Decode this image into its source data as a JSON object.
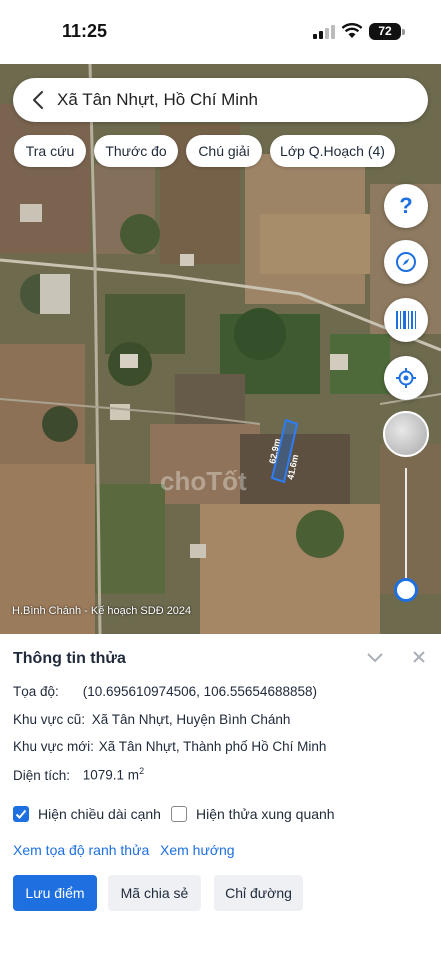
{
  "status_bar": {
    "time": "11:25",
    "battery": "72"
  },
  "search": {
    "location": "Xã Tân Nhựt, Hồ Chí Minh"
  },
  "chips": [
    {
      "label": "Tra cứu"
    },
    {
      "label": "Thước đo"
    },
    {
      "label": "Chú giải"
    },
    {
      "label": "Lớp Q.Hoạch (4)"
    }
  ],
  "map": {
    "caption": "H.Bình Chánh - Kế hoạch SDĐ 2024",
    "parcel_side_a": "62.9m",
    "parcel_side_b": "41.6m",
    "watermark": "choTốt",
    "fab_help": "?",
    "zoom_level_fraction": 0.0
  },
  "info": {
    "title": "Thông tin thửa",
    "coords_label": "Tọa độ:",
    "coords_value": "(10.695610974506, 106.55654688858)",
    "old_area_label": "Khu vực cũ:",
    "old_area_value": "Xã Tân Nhựt, Huyện Bình Chánh",
    "new_area_label": "Khu vực mới:",
    "new_area_value": "Xã Tân Nhựt, Thành phố Hồ Chí Minh",
    "size_label": "Diện tích:",
    "size_value": "1079.1 m",
    "size_unit_sup": "2",
    "checkbox_edges_label": "Hiện chiều dài cạnh",
    "checkbox_edges_checked": true,
    "checkbox_neighbors_label": "Hiện thửa xung quanh",
    "checkbox_neighbors_checked": false,
    "link_coords": "Xem tọa độ ranh thửa",
    "link_direction": "Xem hướng",
    "btn_save": "Lưu điểm",
    "btn_share": "Mã chia sẻ",
    "btn_directions": "Chỉ đường"
  },
  "colors": {
    "accent": "#1e6fe0"
  }
}
